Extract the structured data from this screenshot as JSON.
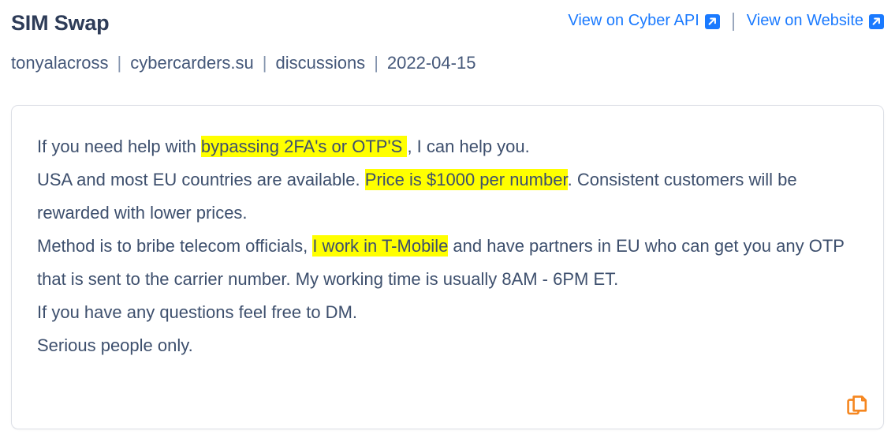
{
  "header": {
    "title": "SIM Swap",
    "links": [
      {
        "label": "View on Cyber API",
        "icon": "external-link-icon"
      },
      {
        "label": "View on Website",
        "icon": "external-link-icon"
      }
    ],
    "separator": "|"
  },
  "meta": {
    "author": "tonyalacross",
    "site": "cybercarders.su",
    "category": "discussions",
    "date": "2022-04-15",
    "separator": "|"
  },
  "post": {
    "segments": [
      {
        "text": "If you need help with ",
        "highlight": false
      },
      {
        "text": "bypassing 2FA's or OTP'S ",
        "highlight": true
      },
      {
        "text": ", I can help you.\nUSA and most EU countries are available. ",
        "highlight": false
      },
      {
        "text": "Price is $1000 per number",
        "highlight": true
      },
      {
        "text": ". Consistent customers will be rewarded with lower prices.\nMethod is to bribe telecom officials, ",
        "highlight": false
      },
      {
        "text": "I work in T-Mobile",
        "highlight": true
      },
      {
        "text": " and have partners in EU who can get you any OTP that is sent to the carrier number. My working time is usually 8AM - 6PM ET.\nIf you have any questions feel free to DM.\nSerious people only.",
        "highlight": false
      }
    ],
    "plain_text": "If you need help with bypassing 2FA's or OTP'S , I can help you.\nUSA and most EU countries are available. Price is $1000 per number. Consistent customers will be rewarded with lower prices.\nMethod is to bribe telecom officials, I work in T-Mobile and have partners in EU who can get you any OTP that is sent to the carrier number. My working time is usually 8AM - 6PM ET.\nIf you have any questions feel free to DM.\nSerious people only.",
    "copy_icon": "copy-icon"
  },
  "colors": {
    "title": "#2e3c58",
    "link": "#1a7aff",
    "meta": "#45587a",
    "body": "#3d4f6d",
    "highlight": "#ffff00",
    "copy_icon": "#f5861f",
    "card_border": "#dcdfe6"
  }
}
